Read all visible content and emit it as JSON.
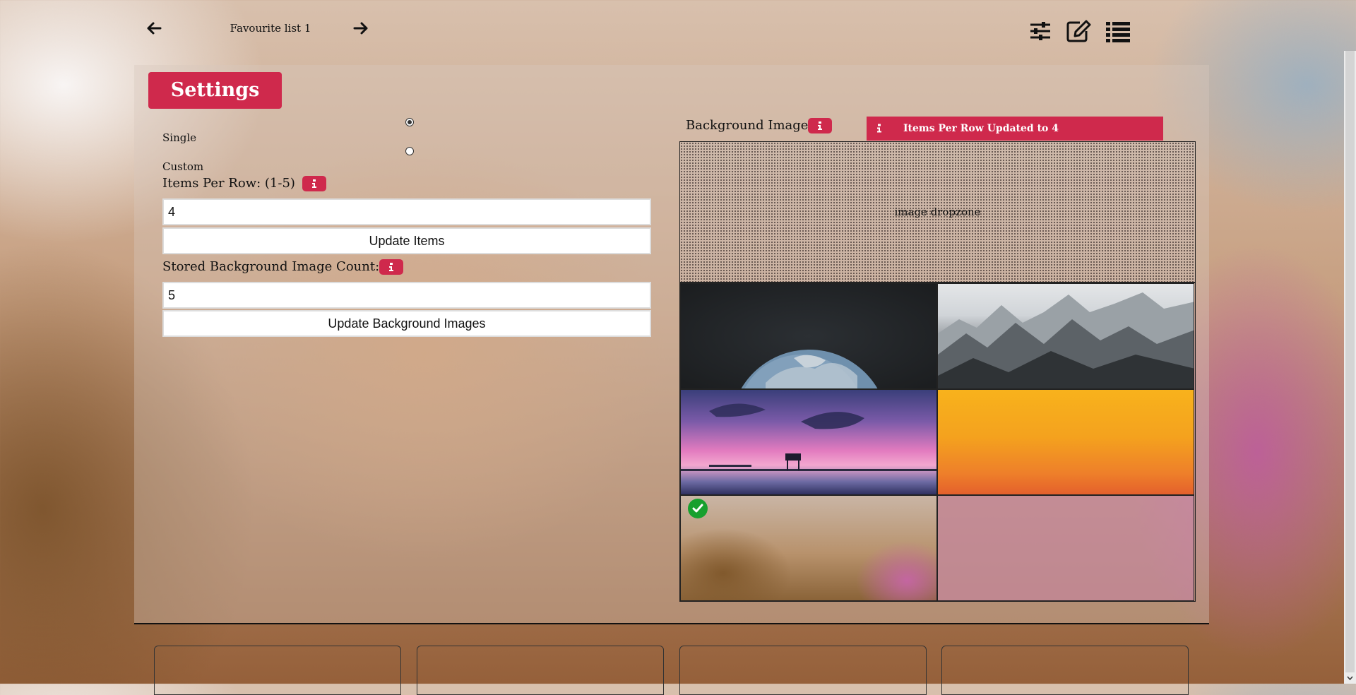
{
  "header": {
    "list_title": "Favourite list 1",
    "icons": [
      "arrow-left-icon",
      "arrow-right-icon",
      "sliders-icon",
      "edit-icon",
      "list-icon"
    ]
  },
  "settings": {
    "title": "Settings",
    "mode_options": [
      {
        "label": "Single",
        "checked": true
      },
      {
        "label": "Custom",
        "checked": false
      }
    ],
    "items_per_row": {
      "label": "Items Per Row: (1-5)",
      "value": "4",
      "button": "Update Items"
    },
    "bg_count": {
      "label": "Stored Background Image Count:",
      "value": "5",
      "button": "Update Background Images"
    }
  },
  "background": {
    "label": "Background Image",
    "toast": "Items Per Row Updated to 4",
    "dropzone": "image dropzone",
    "thumbnails": [
      "earth",
      "mountains",
      "sunset-lake",
      "orange-gradient",
      "blurred-abstract"
    ],
    "selected_index": 4
  },
  "colors": {
    "accent": "#cf294c",
    "check": "#17a02e"
  }
}
